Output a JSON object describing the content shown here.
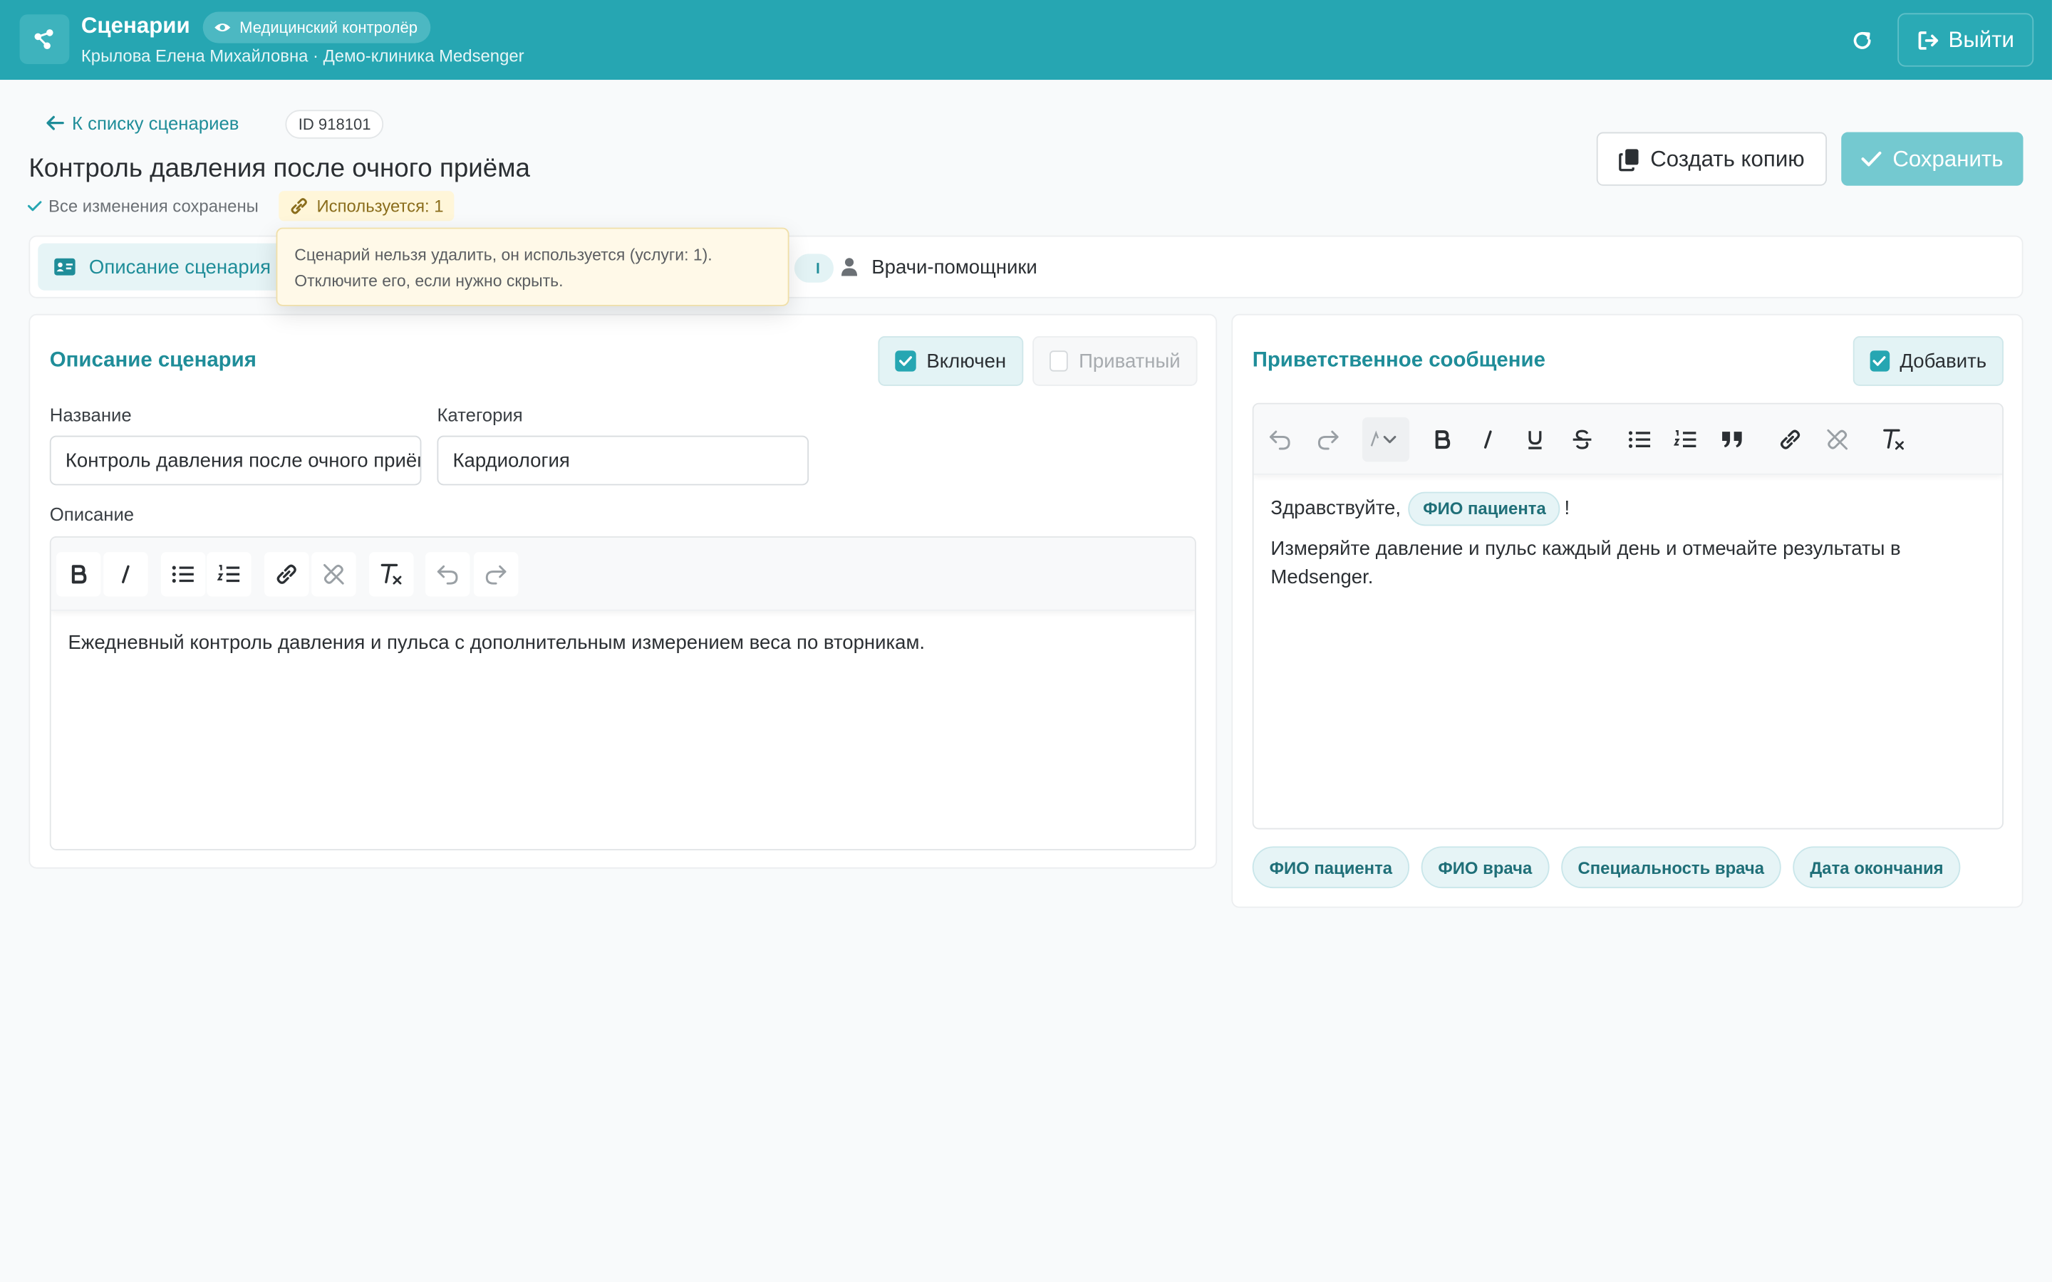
{
  "header": {
    "app_title": "Сценарии",
    "role": "Медицинский контролёр",
    "user_line": "Крылова Елена Михайловна · Демо-клиника Medsenger",
    "logout_label": "Выйти"
  },
  "breadcrumb": {
    "back_label": "К списку сценариев",
    "id_label": "ID 918101"
  },
  "page": {
    "title": "Контроль давления после очного приёма",
    "saved_status": "Все изменения сохранены",
    "usage_label": "Используется: 1",
    "copy_label": "Создать копию",
    "save_label": "Сохранить"
  },
  "tabs": [
    {
      "label": "Описание сценария",
      "active": true
    },
    {
      "label": "Врачи-помощники",
      "active": false
    }
  ],
  "tooltip": {
    "line1": "Сценарий нельзя удалить, он используется (услуги: 1).",
    "line2": "Отключите его, если нужно скрыть."
  },
  "description_card": {
    "title": "Описание сценария",
    "enabled_label": "Включен",
    "enabled": true,
    "private_label": "Приватный",
    "private": false,
    "name_label": "Название",
    "name_value": "Контроль давления после очного приёма",
    "category_label": "Категория",
    "category_value": "Кардиология",
    "description_label": "Описание",
    "description_text": "Ежедневный контроль давления и пульса с дополнительным измерением веса по вторникам."
  },
  "welcome_card": {
    "title": "Приветственное сообщение",
    "add_label": "Добавить",
    "add_checked": true,
    "greeting": "Здравствуйте,",
    "greeting_var": "ФИО пациента",
    "greeting_end": "!",
    "message": "Измеряйте давление и пульс каждый день и отмечайте результаты в Medsenger.",
    "variables": [
      "ФИО пациента",
      "ФИО врача",
      "Специальность врача",
      "Дата окончания"
    ]
  },
  "colors": {
    "brand": "#26a6b2",
    "accent_text": "#1f8d99",
    "save_disabled": "#74c9d0",
    "warning_bg": "#fff6d9"
  }
}
